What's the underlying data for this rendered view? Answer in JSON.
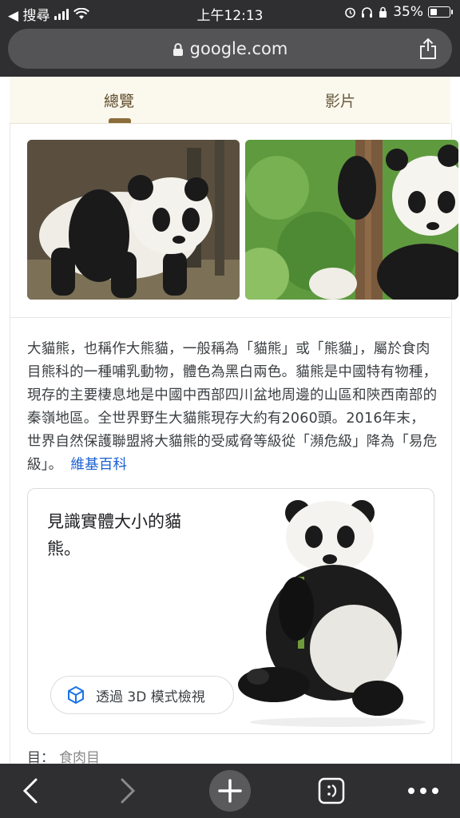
{
  "status_bar": {
    "back_label": "◀ 搜尋",
    "time": "上午12:13",
    "battery": "35%",
    "battery_level": 0.35
  },
  "address_bar": {
    "url": "google.com"
  },
  "tabs": [
    {
      "label": "總覽",
      "selected": true
    },
    {
      "label": "影片",
      "selected": false
    }
  ],
  "description": {
    "text": "大貓熊，也稱作大熊貓，一般稱為「貓熊」或「熊貓」，屬於食肉目熊科的一種哺乳動物，體色為黑白兩色。貓熊是中國特有物種，現存的主要棲息地是中國中西部四川盆地周邊的山區和陝西南部的秦嶺地區。全世界野生大貓熊現存大約有2060頭。2016年末，世界自然保護聯盟將大貓熊的受威脅等級從「瀕危級」降為「易危級」。",
    "source_link": "維基百科"
  },
  "ar_card": {
    "title": "見識實體大小的貓熊。",
    "button_label": "透過 3D 模式檢視"
  },
  "taxonomy": {
    "label": "目：",
    "value": "食肉目"
  },
  "colors": {
    "chrome": "#2f2f31",
    "link": "#1a5fd0",
    "tab_accent": "#8a6d3b"
  }
}
